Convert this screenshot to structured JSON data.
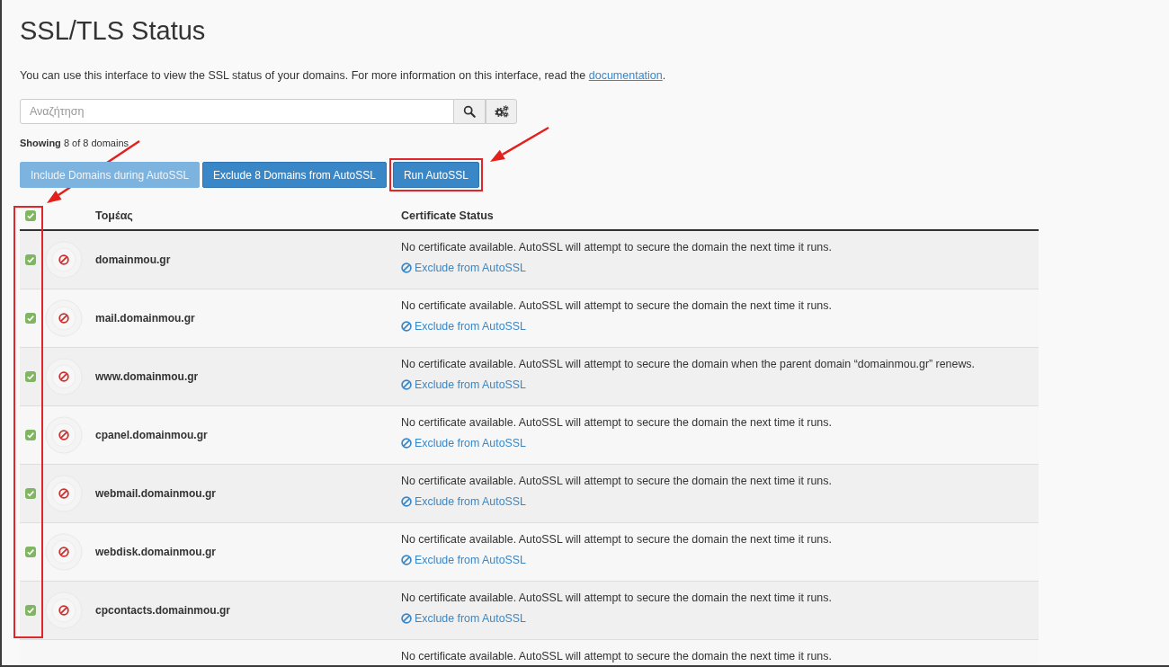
{
  "page": {
    "title": "SSL/TLS Status",
    "description": {
      "text": "You can use this interface to view the SSL status of your domains. For more information on this interface, read the ",
      "link": "documentation",
      "after": "."
    }
  },
  "search": {
    "placeholder": "Αναζήτηση"
  },
  "summary": "**Showing** 8 of 8 domains",
  "buttons": [
    {
      "label": "Include Domains during AutoSSL",
      "disabled": true,
      "highlighted": false
    },
    {
      "label": "Exclude 8 Domains from AutoSSL",
      "disabled": false,
      "highlighted": false
    },
    {
      "label": "Run AutoSSL",
      "disabled": false,
      "highlighted": true
    }
  ],
  "table": {
    "select_all_checked": true,
    "select_column_highlighted": true,
    "columns": [
      "Τομέας",
      "Certificate Status"
    ],
    "rows": [
      {
        "checked": true,
        "kind": "no_cert",
        "domain": "domainmou.gr",
        "status": "No certificate available. AutoSSL will attempt to secure the domain the next time it runs.",
        "action": "Exclude from AutoSSL"
      },
      {
        "checked": true,
        "kind": "no_cert",
        "domain": "mail.domainmou.gr",
        "status": "No certificate available. AutoSSL will attempt to secure the domain the next time it runs.",
        "action": "Exclude from AutoSSL"
      },
      {
        "checked": true,
        "kind": "no_cert",
        "domain": "www.domainmou.gr",
        "status": "No certificate available. AutoSSL will attempt to secure the domain when the parent domain “domainmou.gr” renews.",
        "action": "Exclude from AutoSSL"
      },
      {
        "checked": true,
        "kind": "no_cert",
        "domain": "cpanel.domainmou.gr",
        "status": "No certificate available. AutoSSL will attempt to secure the domain the next time it runs.",
        "action": "Exclude from AutoSSL"
      },
      {
        "checked": true,
        "kind": "no_cert",
        "domain": "webmail.domainmou.gr",
        "status": "No certificate available. AutoSSL will attempt to secure the domain the next time it runs.",
        "action": "Exclude from AutoSSL"
      },
      {
        "checked": true,
        "kind": "no_cert",
        "domain": "webdisk.domainmou.gr",
        "status": "No certificate available. AutoSSL will attempt to secure the domain the next time it runs.",
        "action": "Exclude from AutoSSL"
      },
      {
        "checked": true,
        "kind": "no_cert",
        "domain": "cpcontacts.domainmou.gr",
        "status": "No certificate available. AutoSSL will attempt to secure the domain the next time it runs.",
        "action": "Exclude from AutoSSL"
      }
    ],
    "cut_off_row": {
      "status": "No certificate available. AutoSSL will attempt to secure the domain the next time it runs."
    }
  }
}
